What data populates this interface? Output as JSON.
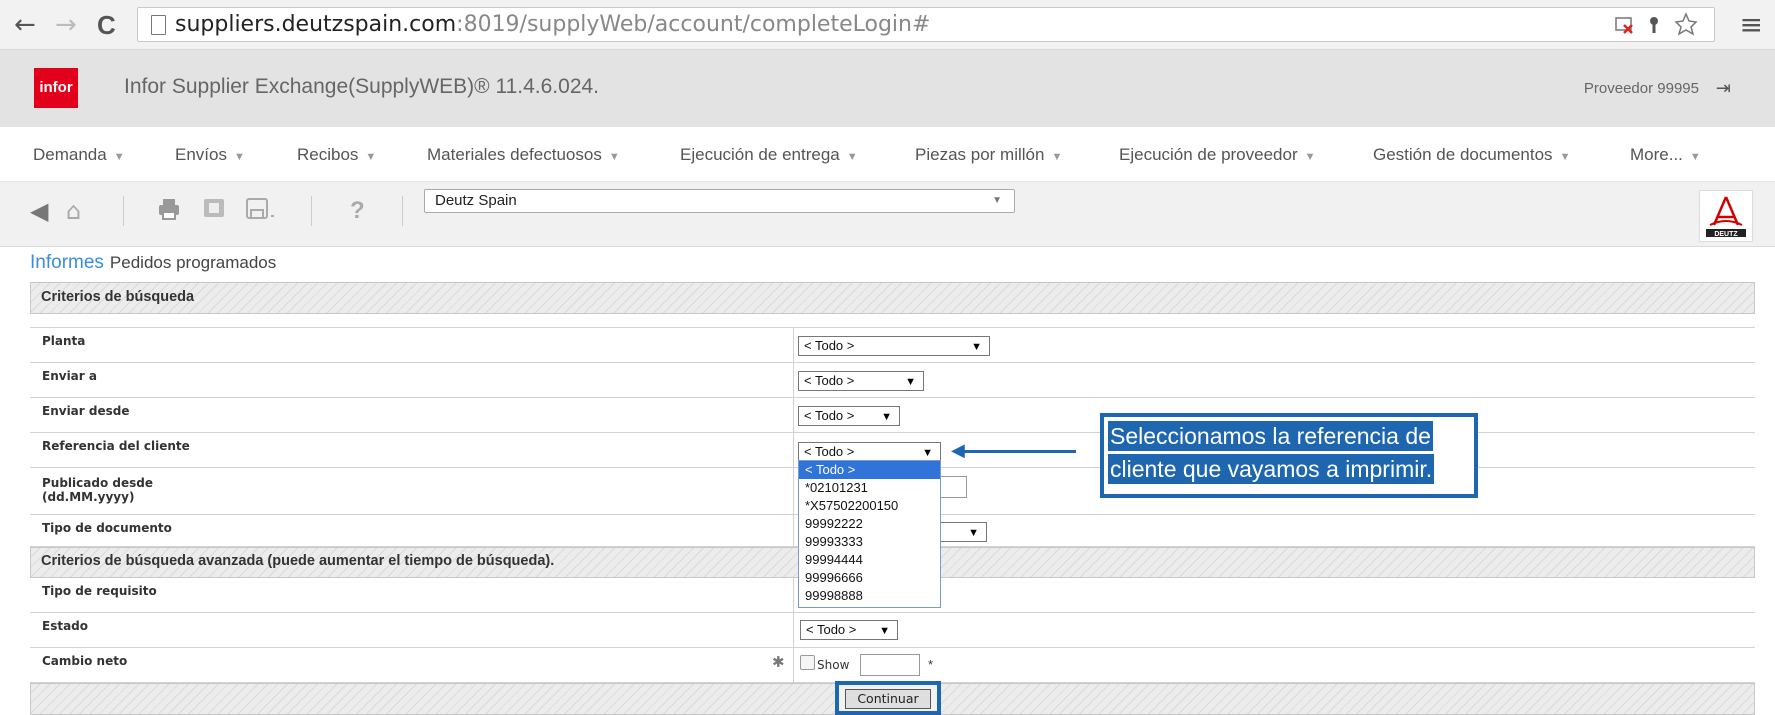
{
  "browser": {
    "back": "←",
    "forward": "→",
    "reload": "C",
    "url_host": "suppliers.deutzspain.com",
    "url_rest": ":8019/supplyWeb/account/completeLogin#",
    "menu": "≡"
  },
  "header": {
    "logo_text": "infor",
    "title": "Infor Supplier Exchange(SupplyWEB)® 11.4.6.024.",
    "user": "Proveedor 99995"
  },
  "nav": {
    "items": [
      {
        "label": "Demanda"
      },
      {
        "label": "Envíos"
      },
      {
        "label": "Recibos"
      },
      {
        "label": "Materiales defectuosos"
      },
      {
        "label": "Ejecución de entrega"
      },
      {
        "label": "Piezas por millón"
      },
      {
        "label": "Ejecución de proveedor"
      },
      {
        "label": "Gestión de documentos"
      },
      {
        "label": "More..."
      }
    ]
  },
  "toolbar": {
    "help": "?",
    "supplier_value": "Deutz Spain"
  },
  "breadcrumb": {
    "section": "Informes",
    "page": "Pedidos programados"
  },
  "form": {
    "search_criteria_title": "Criterios de búsqueda",
    "advanced_title": "Criterios de búsqueda avanzada (puede aumentar el tiempo de búsqueda).",
    "rows": [
      {
        "label": "Planta",
        "value": "< Todo >"
      },
      {
        "label": "Enviar a",
        "value": "< Todo >"
      },
      {
        "label": "Enviar desde",
        "value": "< Todo >"
      },
      {
        "label": "Referencia del cliente",
        "value": "< Todo >"
      },
      {
        "label": "Publicado desde\n(dd.MM.yyyy)",
        "value": ""
      },
      {
        "label": "Tipo de documento",
        "value": ""
      },
      {
        "label": "Tipo de requisito",
        "value": ""
      },
      {
        "label": "Estado",
        "value": "< Todo >"
      },
      {
        "label": "Cambio neto",
        "value": ""
      }
    ],
    "show_label": "Show",
    "asterisk": "*",
    "continue_label": "Continuar"
  },
  "dropdown": {
    "options": [
      "< Todo >",
      "*02101231",
      "*X57502200150",
      "99992222",
      "99993333",
      "99994444",
      "99996666",
      "99998888"
    ],
    "selected_index": 0
  },
  "callout": {
    "line1": "Seleccionamos la referencia de",
    "line2": "cliente que vayamos a imprimir."
  },
  "colors": {
    "accent_blue": "#1f66b0",
    "infor_red": "#e2001a",
    "link_blue": "#3a8dde"
  }
}
